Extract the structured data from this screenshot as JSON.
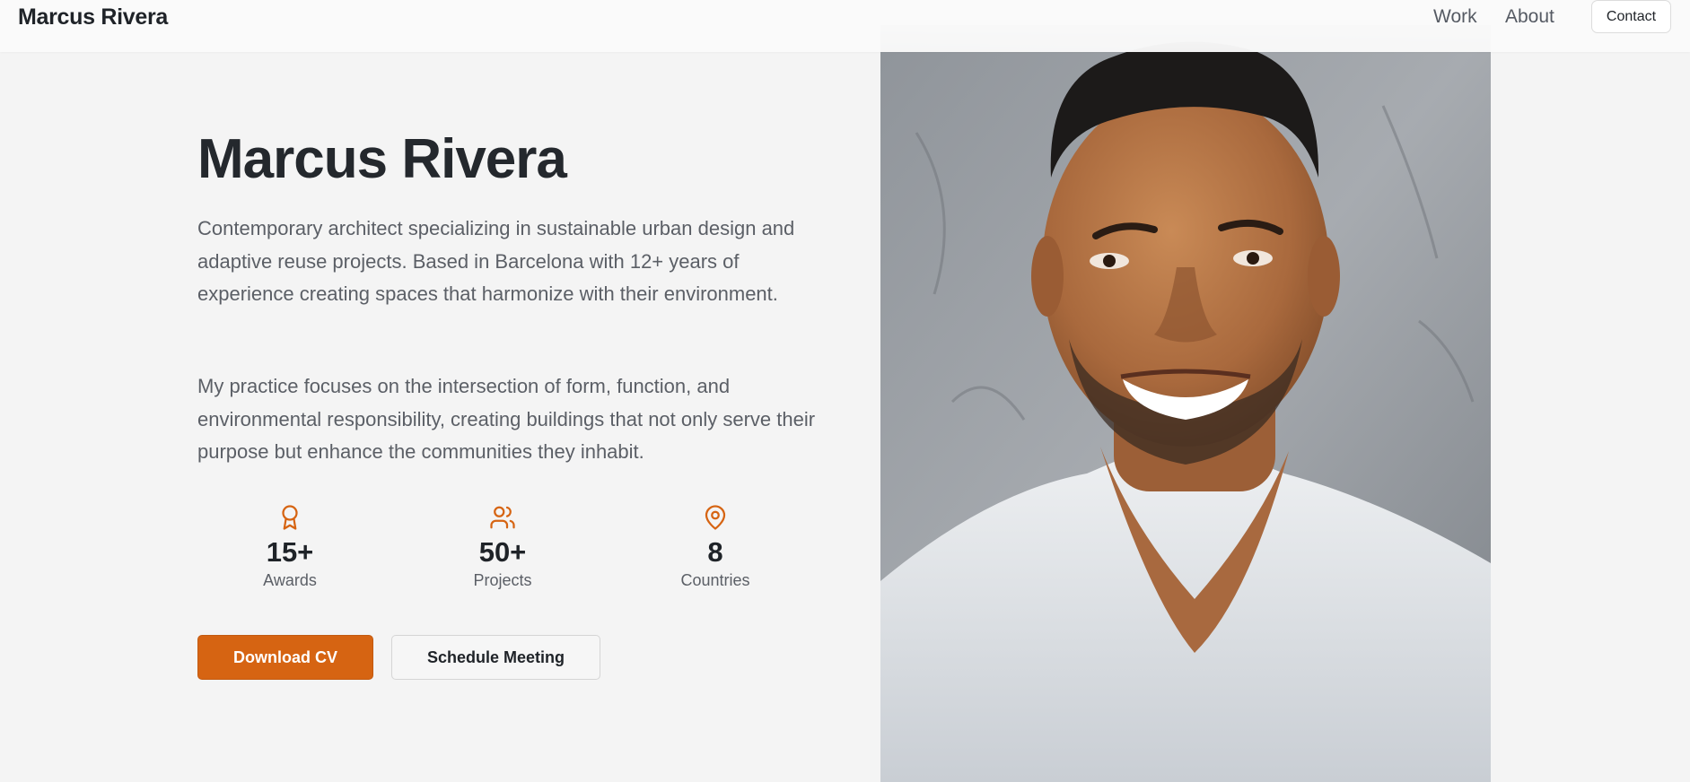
{
  "nav": {
    "brand": "Marcus Rivera",
    "links": [
      {
        "label": "Work"
      },
      {
        "label": "About"
      }
    ],
    "contact_label": "Contact"
  },
  "hero": {
    "title": "Marcus Rivera",
    "paragraphs": [
      "Contemporary architect specializing in sustainable urban design and adaptive reuse projects. Based in Barcelona with 12+ years of experience creating spaces that harmonize with their environment.",
      "My practice focuses on the intersection of form, function, and environmental responsibility, creating buildings that not only serve their purpose but enhance the communities they inhabit."
    ],
    "stats": [
      {
        "icon": "award-icon",
        "value": "15+",
        "label": "Awards"
      },
      {
        "icon": "users-icon",
        "value": "50+",
        "label": "Projects"
      },
      {
        "icon": "map-pin-icon",
        "value": "8",
        "label": "Countries"
      }
    ],
    "buttons": {
      "primary_label": "Download CV",
      "secondary_label": "Schedule Meeting"
    }
  },
  "portrait": {
    "alt": "Portrait photo"
  },
  "colors": {
    "accent": "#d66412",
    "background": "#f4f4f4",
    "heading": "#24282d",
    "body_text": "#5b5f66"
  }
}
